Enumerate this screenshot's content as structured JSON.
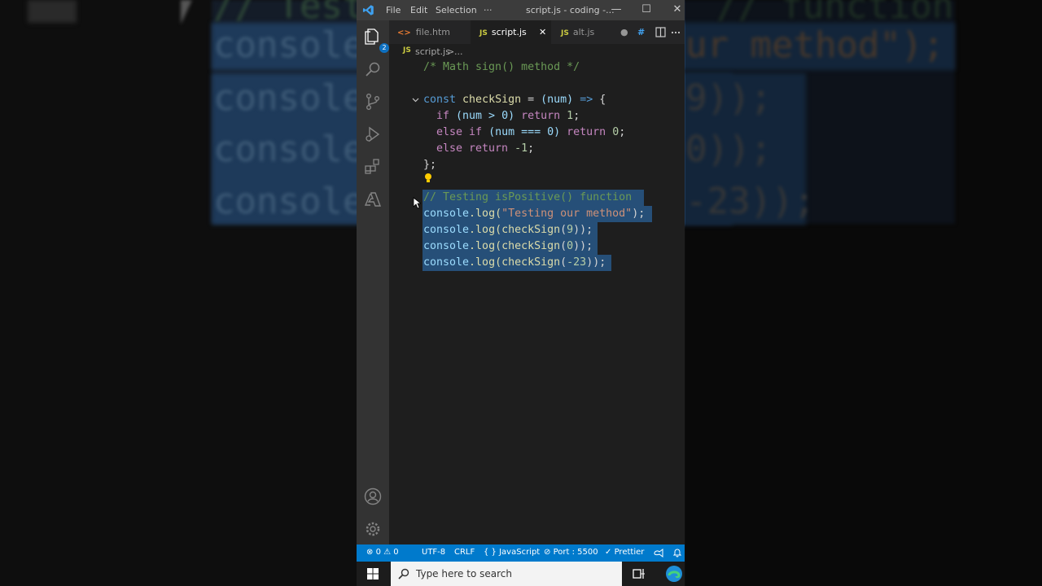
{
  "background": {
    "lines": [
      "// Test",
      "console",
      "console",
      "console",
      "console"
    ],
    "right_lines": [
      "// function",
      "ur method\");",
      "9));",
      "0));",
      "-23));"
    ]
  },
  "titlebar": {
    "menu": [
      "File",
      "Edit",
      "Selection",
      "···"
    ],
    "title": "script.js - coding -...",
    "minimize": "—",
    "maximize": "☐",
    "close": "✕"
  },
  "activity_bar": {
    "explorer_badge": "2",
    "icons": [
      "files-icon",
      "search-icon",
      "source-control-icon",
      "run-debug-icon",
      "extensions-icon",
      "azure-icon",
      "account-icon",
      "settings-gear-icon"
    ]
  },
  "tabs": [
    {
      "label": "file.htm",
      "kind": "html",
      "icon_text": "<>"
    },
    {
      "label": "script.js",
      "kind": "js",
      "icon_text": "JS",
      "active": true,
      "close": "✕"
    },
    {
      "label": "alt.js",
      "kind": "js",
      "icon_text": "JS",
      "dirty": "●"
    },
    {
      "label": "#",
      "kind": "css"
    }
  ],
  "breadcrumb": {
    "icon_text": "JS",
    "file": "script.js",
    "sep": ">",
    "rest": "..."
  },
  "code": {
    "line1": "/* Math sign() method */",
    "line2": [
      "const",
      "checkSign",
      "=",
      "(num)",
      "=>",
      "{"
    ],
    "line3": [
      "if",
      "(num > 0)",
      "return",
      "1",
      ";"
    ],
    "line4": [
      "else if",
      "(num === 0)",
      "return",
      "0",
      ";"
    ],
    "line5": [
      "else return",
      "-1",
      ";"
    ],
    "line6": "};",
    "line7": "// Testing isPositive() function",
    "line8": [
      "console",
      ".log(",
      "\"Testing our method\"",
      ");"
    ],
    "line9": [
      "console",
      ".log(",
      "checkSign",
      "(",
      "9",
      "));"
    ],
    "line10": [
      "console",
      ".log(",
      "checkSign",
      "(",
      "0",
      "));"
    ],
    "line11": [
      "console",
      ".log(",
      "checkSign",
      "(",
      "-23",
      "));"
    ]
  },
  "statusbar": {
    "errors": "0",
    "warnings": "0",
    "encoding": "UTF-8",
    "eol": "CRLF",
    "language": "JavaScript",
    "port": "Port : 5500",
    "prettier": "Prettier"
  },
  "taskbar": {
    "search_placeholder": "Type here to search"
  },
  "colors": {
    "accent": "#007acc",
    "selection": "#264f78",
    "editor_bg": "#1e1e1e"
  }
}
